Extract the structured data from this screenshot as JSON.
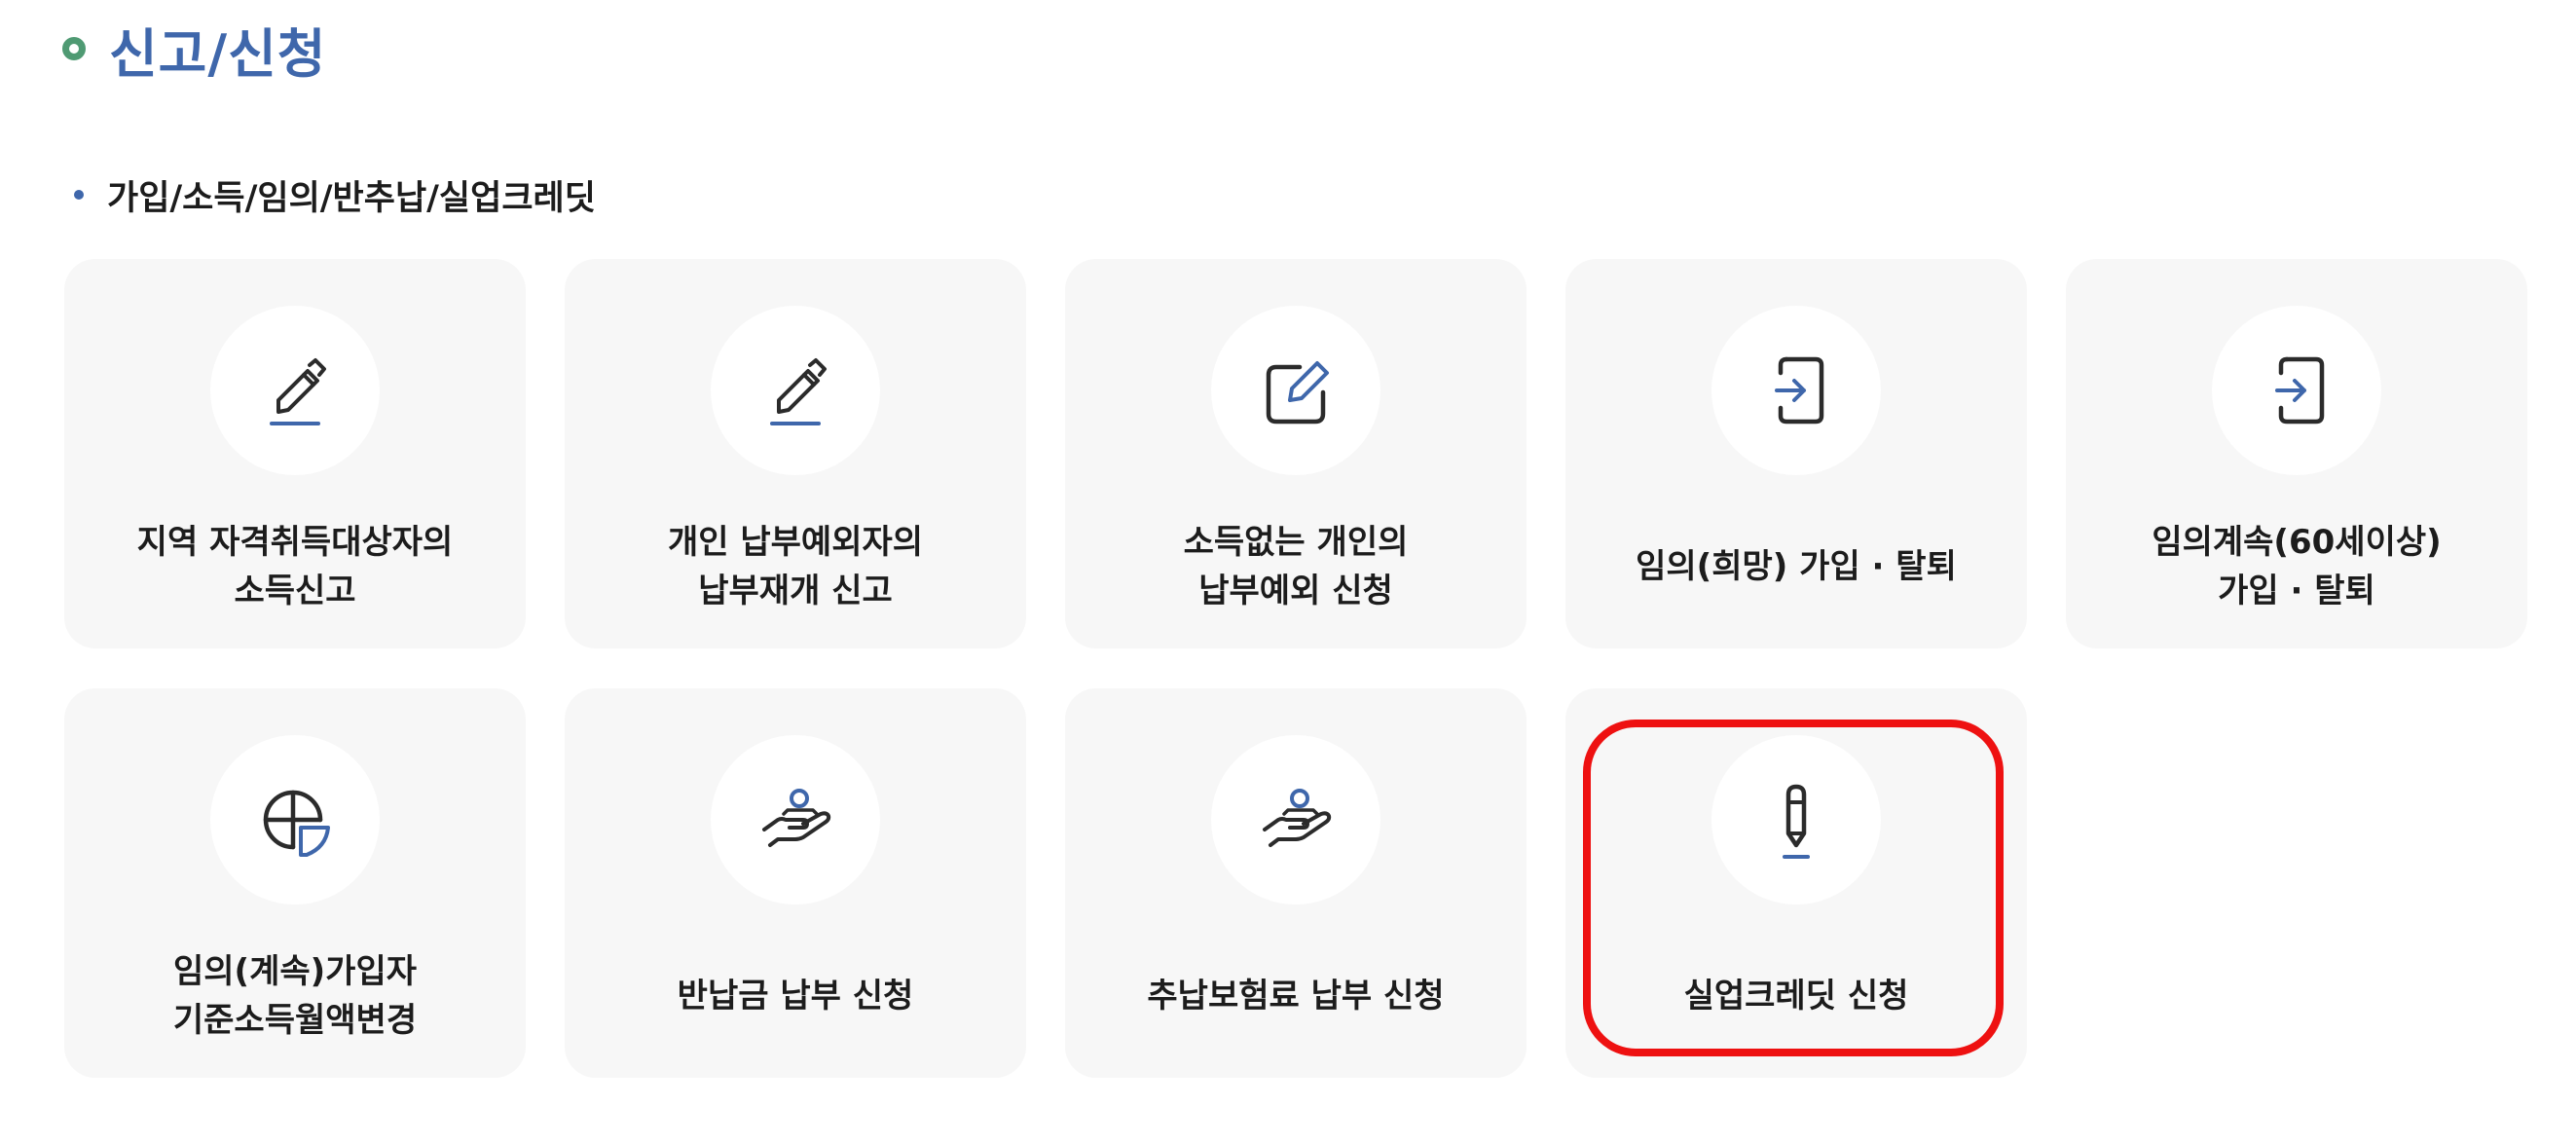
{
  "page": {
    "title": "신고/신청"
  },
  "section": {
    "title": "가입/소득/임의/반추납/실업크레딧"
  },
  "colors": {
    "accent": "#3f67ab",
    "bullet": "#4f9a73",
    "card_bg": "#f7f7f7",
    "highlight": "#ee1111"
  },
  "cards": [
    {
      "icon": "pencil-edit-icon",
      "lines": [
        "지역 자격취득대상자의",
        "소득신고"
      ]
    },
    {
      "icon": "pencil-edit-icon",
      "lines": [
        "개인 납부예외자의",
        "납부재개 신고"
      ]
    },
    {
      "icon": "edit-document-icon",
      "lines": [
        "소득없는 개인의",
        "납부예외 신청"
      ]
    },
    {
      "icon": "sign-in-icon",
      "lines": [
        "임의(희망) 가입 · 탈퇴"
      ]
    },
    {
      "icon": "sign-in-icon",
      "lines": [
        "임의계속(60세이상)",
        "가입 · 탈퇴"
      ]
    },
    {
      "icon": "pie-chart-icon",
      "lines": [
        "임의(계속)가입자",
        "기준소득월액변경"
      ]
    },
    {
      "icon": "hand-person-icon",
      "lines": [
        "반납금 납부 신청"
      ]
    },
    {
      "icon": "hand-person-icon",
      "lines": [
        "추납보험료 납부 신청"
      ]
    },
    {
      "icon": "pen-icon",
      "lines": [
        "실업크레딧 신청"
      ],
      "highlighted": true
    }
  ]
}
